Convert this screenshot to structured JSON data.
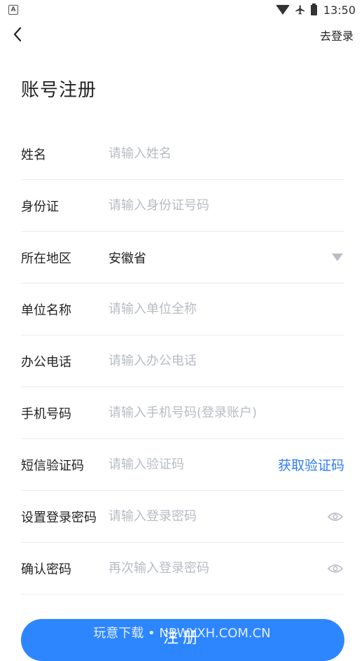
{
  "statusbar": {
    "time": "13:50"
  },
  "header": {
    "back_label": "",
    "login_link": "去登录"
  },
  "page_title": "账号注册",
  "form": {
    "name": {
      "label": "姓名",
      "placeholder": "请输入姓名"
    },
    "id_card": {
      "label": "身份证",
      "placeholder": "请输入身份证号码"
    },
    "region": {
      "label": "所在地区",
      "value": "安徽省"
    },
    "company": {
      "label": "单位名称",
      "placeholder": "请输入单位全称"
    },
    "office_phone": {
      "label": "办公电话",
      "placeholder": "请输入办公电话"
    },
    "mobile": {
      "label": "手机号码",
      "placeholder": "请输入手机号码(登录账户)"
    },
    "sms_code": {
      "label": "短信验证码",
      "placeholder": "请输入验证码",
      "action": "获取验证码"
    },
    "password": {
      "label": "设置登录密码",
      "placeholder": "请输入登录密码"
    },
    "confirm_password": {
      "label": "确认密码",
      "placeholder": "再次输入登录密码"
    }
  },
  "submit_label": "注册",
  "watermark": "玩意下载 • NBWYXH.COM.CN",
  "colors": {
    "accent": "#2e86ff",
    "link": "#2e7cf6",
    "placeholder": "#b7bcc4"
  }
}
